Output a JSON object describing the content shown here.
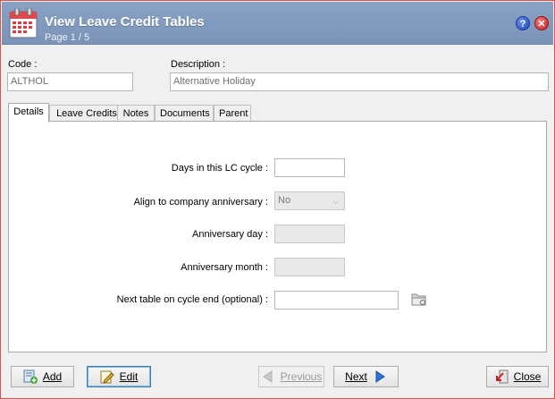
{
  "window": {
    "title": "View Leave Credit Tables",
    "subtitle": "Page 1 / 5",
    "help_glyph": "?",
    "close_glyph": "✕",
    "app_icon": "calendar-icon",
    "colors": {
      "titlebar": "#7f97bb",
      "close": "#c51f1f",
      "help": "#1c46c2"
    }
  },
  "header": {
    "code_label": "Code :",
    "code_value": "ALTHOL",
    "description_label": "Description :",
    "description_value": "Alternative Holiday"
  },
  "tabs": [
    {
      "label": "Details",
      "active": true
    },
    {
      "label": "Leave Credits",
      "active": false
    },
    {
      "label": "Notes",
      "active": false
    },
    {
      "label": "Documents",
      "active": false
    },
    {
      "label": "Parent",
      "active": false
    }
  ],
  "details": {
    "days_label": "Days in this LC cycle :",
    "days_value": "",
    "align_label": "Align to company anniversary :",
    "align_value": "No",
    "anniv_day_label": "Anniversary day :",
    "anniv_day_value": "",
    "anniv_month_label": "Anniversary month :",
    "anniv_month_value": "",
    "next_table_label": "Next table on cycle end (optional) :",
    "next_table_value": ""
  },
  "buttons": {
    "add": "Add",
    "edit": "Edit",
    "previous": "Previous",
    "next": "Next",
    "close": "Close"
  }
}
